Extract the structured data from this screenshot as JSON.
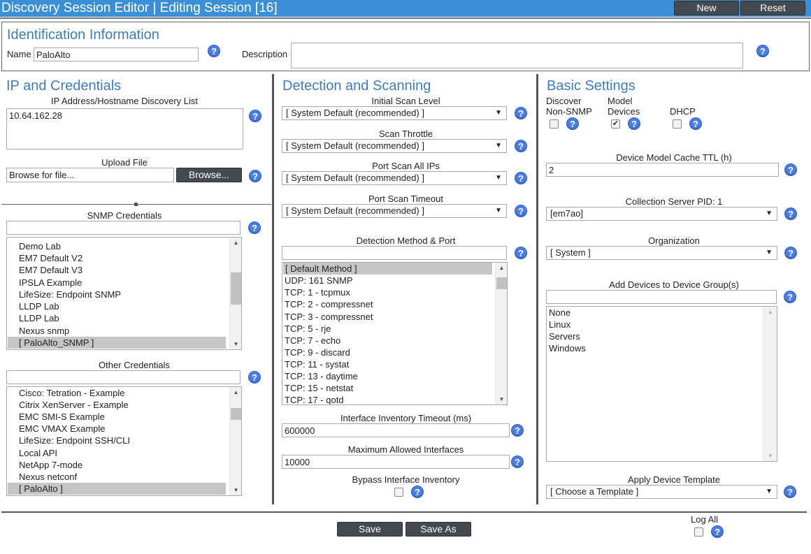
{
  "header": {
    "title": "Discovery Session Editor | Editing Session [16]",
    "new_label": "New",
    "reset_label": "Reset"
  },
  "identification": {
    "title": "Identification Information",
    "name_label": "Name",
    "name_value": "PaloAlto",
    "description_label": "Description",
    "description_value": ""
  },
  "ip_credentials": {
    "title": "IP and Credentials",
    "ip_list_label": "IP Address/Hostname Discovery List",
    "ip_list_value": "10.64.162.28",
    "upload_label": "Upload File",
    "upload_placeholder": "Browse for file...",
    "browse_label": "Browse...",
    "snmp_label": "SNMP Credentials",
    "snmp_filter": "",
    "snmp_items": [
      "Demo Lab",
      "EM7 Default V2",
      "EM7 Default V3",
      "IPSLA Example",
      "LifeSize: Endpoint SNMP",
      "LLDP Lab",
      "LLDP Lab",
      "Nexus snmp",
      "[ PaloAlto_SNMP ]"
    ],
    "other_label": "Other Credentials",
    "other_filter": "",
    "other_items": [
      "Cisco: Tetration - Example",
      "Citrix XenServer - Example",
      "EMC SMI-S Example",
      "EMC VMAX Example",
      "LifeSize: Endpoint SSH/CLI",
      "Local API",
      "NetApp 7-mode",
      "Nexus netconf",
      "[ PaloAlto ]"
    ]
  },
  "detection": {
    "title": "Detection and Scanning",
    "initial_scan_label": "Initial Scan Level",
    "initial_scan_value": "[ System Default (recommended) ]",
    "scan_throttle_label": "Scan Throttle",
    "scan_throttle_value": "[ System Default (recommended) ]",
    "port_scan_all_label": "Port Scan All IPs",
    "port_scan_all_value": "[ System Default (recommended) ]",
    "port_scan_timeout_label": "Port Scan Timeout",
    "port_scan_timeout_value": "[ System Default (recommended) ]",
    "method_label": "Detection Method & Port",
    "method_filter": "",
    "method_items": [
      "[ Default Method ]",
      "UDP: 161 SNMP",
      "TCP: 1 - tcpmux",
      "TCP: 2 - compressnet",
      "TCP: 3 - compressnet",
      "TCP: 5 - rje",
      "TCP: 7 - echo",
      "TCP: 9 - discard",
      "TCP: 11 - systat",
      "TCP: 13 - daytime",
      "TCP: 15 - netstat",
      "TCP: 17 - qotd"
    ],
    "iface_timeout_label": "Interface Inventory Timeout (ms)",
    "iface_timeout_value": "600000",
    "max_iface_label": "Maximum Allowed Interfaces",
    "max_iface_value": "10000",
    "bypass_label": "Bypass Interface Inventory"
  },
  "basic": {
    "title": "Basic Settings",
    "discover_label_1": "Discover",
    "discover_label_2": "Non-SNMP",
    "model_label_1": "Model",
    "model_label_2": "Devices",
    "dhcp_label": "DHCP",
    "cache_ttl_label": "Device Model Cache TTL (h)",
    "cache_ttl_value": "2",
    "collection_label": "Collection Server PID: 1",
    "collection_value": "[em7ao]",
    "org_label": "Organization",
    "org_value": "[ System ]",
    "group_label": "Add Devices to Device Group(s)",
    "group_filter": "",
    "group_items": [
      "None",
      "Linux",
      "Servers",
      "Windows"
    ],
    "template_label": "Apply Device Template",
    "template_value": "[ Choose a Template ]"
  },
  "footer": {
    "save_label": "Save",
    "save_as_label": "Save As",
    "log_all_label": "Log All"
  }
}
